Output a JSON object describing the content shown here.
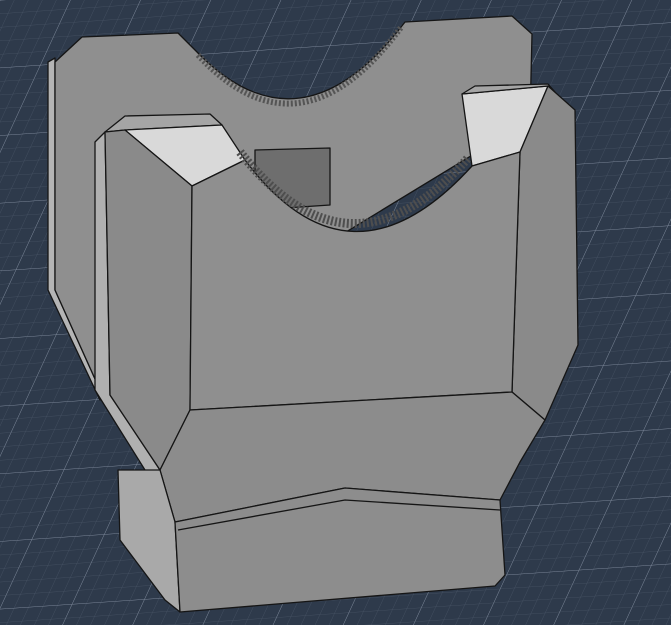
{
  "viewport": {
    "kind": "3d-model-view",
    "colors": {
      "background": "#2e3a4b",
      "grid_minor": "#4a5668",
      "grid_major": "#7c8799",
      "face_main": "#8f8f8f",
      "face_light": "#d9d9d9",
      "face_side": "#b0b0b0",
      "face_dark": "#6e6e6e",
      "edge": "#151515"
    }
  }
}
